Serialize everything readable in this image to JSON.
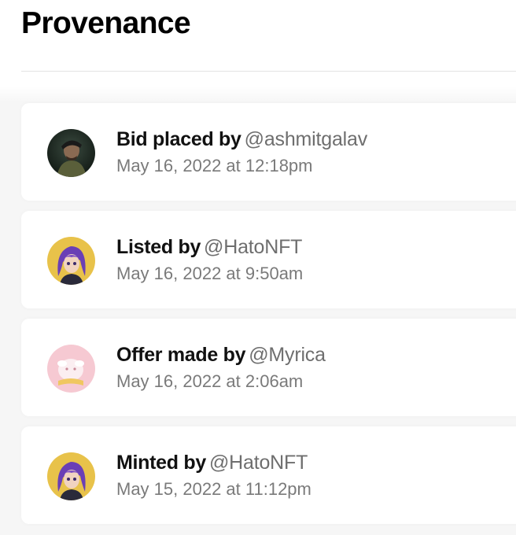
{
  "section": {
    "title": "Provenance"
  },
  "events": [
    {
      "action": "Bid placed by",
      "handle": "@ashmitgalav",
      "date": "May 16, 2022 at 12:18pm",
      "avatar_icon": "user-photo-avatar"
    },
    {
      "action": "Listed by",
      "handle": "@HatoNFT",
      "date": "May 16, 2022 at 9:50am",
      "avatar_icon": "purple-hair-character-avatar"
    },
    {
      "action": "Offer made by",
      "handle": "@Myrica",
      "date": "May 16, 2022 at 2:06am",
      "avatar_icon": "pink-sheep-avatar"
    },
    {
      "action": "Minted by",
      "handle": "@HatoNFT",
      "date": "May 15, 2022 at 11:12pm",
      "avatar_icon": "purple-hair-character-avatar"
    }
  ],
  "colors": {
    "title": "#000000",
    "action_text": "#111111",
    "handle_text": "#6e6e6e",
    "date_text": "#7a7a7a",
    "card_background": "#ffffff",
    "page_background": "#f6f6f6",
    "avatar_yellow": "#e8c24a",
    "avatar_purple": "#6a3fb5",
    "avatar_pink": "#f6c9d2"
  }
}
